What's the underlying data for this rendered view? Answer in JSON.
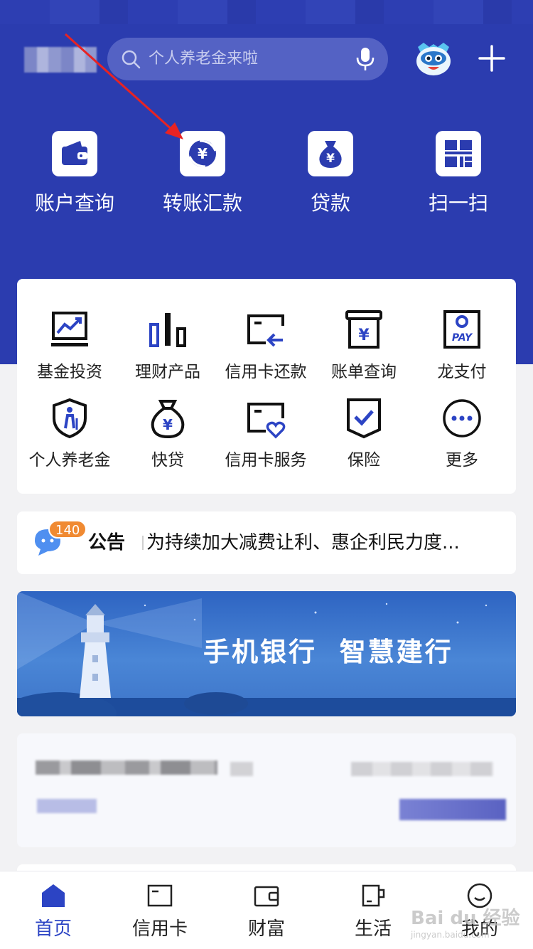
{
  "search": {
    "placeholder": "个人养老金来啦"
  },
  "quick_actions": [
    {
      "label": "账户查询",
      "icon": "wallet-icon"
    },
    {
      "label": "转账汇款",
      "icon": "yuan-transfer-icon"
    },
    {
      "label": "贷款",
      "icon": "money-bag-icon"
    },
    {
      "label": "扫一扫",
      "icon": "scan-icon"
    }
  ],
  "services": [
    {
      "label": "基金投资",
      "icon": "chart-monitor-icon"
    },
    {
      "label": "理财产品",
      "icon": "bar-chart-icon"
    },
    {
      "label": "信用卡还款",
      "icon": "card-repay-icon"
    },
    {
      "label": "账单查询",
      "icon": "bill-icon"
    },
    {
      "label": "龙支付",
      "icon": "pay-icon"
    },
    {
      "label": "个人养老金",
      "icon": "pension-shield-icon"
    },
    {
      "label": "快贷",
      "icon": "money-bag-outline-icon"
    },
    {
      "label": "信用卡服务",
      "icon": "card-heart-icon"
    },
    {
      "label": "保险",
      "icon": "insurance-check-icon"
    },
    {
      "label": "更多",
      "icon": "more-icon"
    }
  ],
  "pay_text": "PAY",
  "notice": {
    "badge": "140",
    "title": "公告",
    "text": "为持续加大减费让利、惠企利民力度..."
  },
  "banner": {
    "slogan": "手机银行  智慧建行"
  },
  "tabs": [
    {
      "label": "首页",
      "active": true
    },
    {
      "label": "信用卡",
      "active": false
    },
    {
      "label": "财富",
      "active": false
    },
    {
      "label": "生活",
      "active": false
    },
    {
      "label": "我的",
      "active": false
    }
  ],
  "watermark": {
    "main": "Bai du 经验",
    "sub": "jingyan.baidu.com"
  },
  "colors": {
    "brand_blue": "#2b3caf",
    "accent_blue": "#2c44c4",
    "badge_orange": "#f08a32",
    "arrow_red": "#e82323"
  }
}
